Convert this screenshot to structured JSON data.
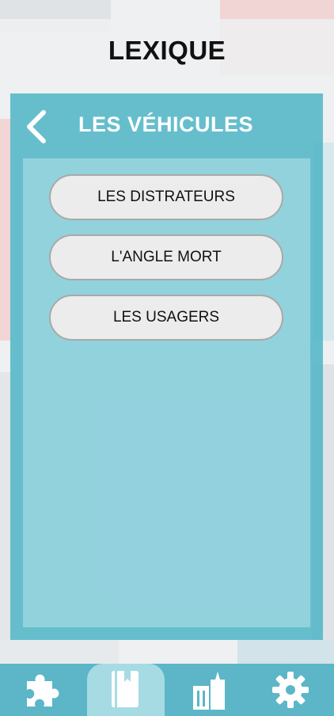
{
  "header": {
    "title": "LEXIQUE"
  },
  "panel": {
    "title": "LES VÉHICULES",
    "items": [
      {
        "label": "LES DISTRATEURS"
      },
      {
        "label": "L'ANGLE MORT"
      },
      {
        "label": "LES USAGERS"
      }
    ]
  },
  "bottom_nav": {
    "tabs": [
      {
        "icon": "puzzle-icon",
        "active": false
      },
      {
        "icon": "book-icon",
        "active": true
      },
      {
        "icon": "building-icon",
        "active": false
      },
      {
        "icon": "gear-icon",
        "active": false
      }
    ]
  },
  "colors": {
    "panel": "#48b2c4",
    "nav": "#5cb6c8",
    "active_tab": "#a6dbe4",
    "pill_bg": "#ececec"
  }
}
